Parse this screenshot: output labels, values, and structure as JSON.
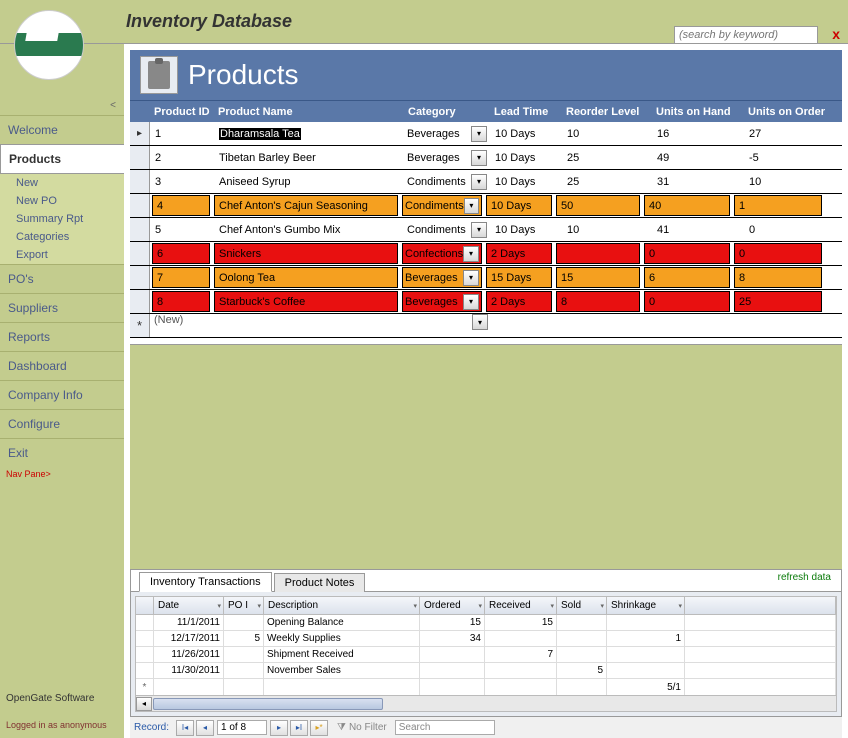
{
  "header": {
    "title": "Inventory Database",
    "search_placeholder": "(search by keyword)",
    "close": "x"
  },
  "nav": {
    "collapse": "<",
    "items": [
      "Welcome",
      "Products",
      "PO's",
      "Suppliers",
      "Reports",
      "Dashboard",
      "Company Info",
      "Configure",
      "Exit"
    ],
    "sub_products": [
      "New",
      "New PO",
      "Summary Rpt",
      "Categories",
      "Export"
    ],
    "nav_pane": "Nav Pane>",
    "company": "OpenGate Software",
    "login": "Logged in as anonymous"
  },
  "products": {
    "title": "Products",
    "columns": [
      "Product ID",
      "Product Name",
      "Category",
      "Lead Time",
      "Reorder Level",
      "Units on Hand",
      "Units on Order"
    ],
    "rows": [
      {
        "id": "1",
        "name": "Dharamsala Tea",
        "cat": "Beverages",
        "lead": "10 Days",
        "reorder": "10",
        "hand": "16",
        "order": "27",
        "state": "selected"
      },
      {
        "id": "2",
        "name": "Tibetan Barley Beer",
        "cat": "Beverages",
        "lead": "10 Days",
        "reorder": "25",
        "hand": "49",
        "order": "-5",
        "state": ""
      },
      {
        "id": "3",
        "name": "Aniseed Syrup",
        "cat": "Condiments",
        "lead": "10 Days",
        "reorder": "25",
        "hand": "31",
        "order": "10",
        "state": ""
      },
      {
        "id": "4",
        "name": "Chef Anton's Cajun Seasoning",
        "cat": "Condiments",
        "lead": "10 Days",
        "reorder": "50",
        "hand": "40",
        "order": "1",
        "state": "orange"
      },
      {
        "id": "5",
        "name": "Chef Anton's Gumbo Mix",
        "cat": "Condiments",
        "lead": "10 Days",
        "reorder": "10",
        "hand": "41",
        "order": "0",
        "state": ""
      },
      {
        "id": "6",
        "name": "Snickers",
        "cat": "Confections",
        "lead": "2 Days",
        "reorder": "",
        "hand": "0",
        "order": "0",
        "state": "red"
      },
      {
        "id": "7",
        "name": "Oolong Tea",
        "cat": "Beverages",
        "lead": "15 Days",
        "reorder": "15",
        "hand": "6",
        "order": "8",
        "state": "orange"
      },
      {
        "id": "8",
        "name": "Starbuck's Coffee",
        "cat": "Beverages",
        "lead": "2 Days",
        "reorder": "8",
        "hand": "0",
        "order": "25",
        "state": "red"
      }
    ],
    "new_label": "(New)"
  },
  "tabs": {
    "items": [
      "Inventory Transactions",
      "Product Notes"
    ],
    "refresh": "refresh data"
  },
  "transactions": {
    "columns": [
      "Date",
      "PO I",
      "Description",
      "Ordered",
      "Received",
      "Sold",
      "Shrinkage"
    ],
    "rows": [
      {
        "date": "11/1/2011",
        "po": "",
        "desc": "Opening Balance",
        "ord": "15",
        "rec": "15",
        "sold": "",
        "shr": ""
      },
      {
        "date": "12/17/2011",
        "po": "5",
        "desc": "Weekly Supplies",
        "ord": "34",
        "rec": "",
        "sold": "",
        "shr": "1"
      },
      {
        "date": "11/26/2011",
        "po": "",
        "desc": "Shipment Received",
        "ord": "",
        "rec": "7",
        "sold": "",
        "shr": ""
      },
      {
        "date": "11/30/2011",
        "po": "",
        "desc": "November Sales",
        "ord": "",
        "rec": "",
        "sold": "5",
        "shr": ""
      }
    ],
    "trailing": "5/1"
  },
  "recnav": {
    "label": "Record:",
    "position": "1 of 8",
    "filter": "No Filter",
    "search": "Search"
  }
}
